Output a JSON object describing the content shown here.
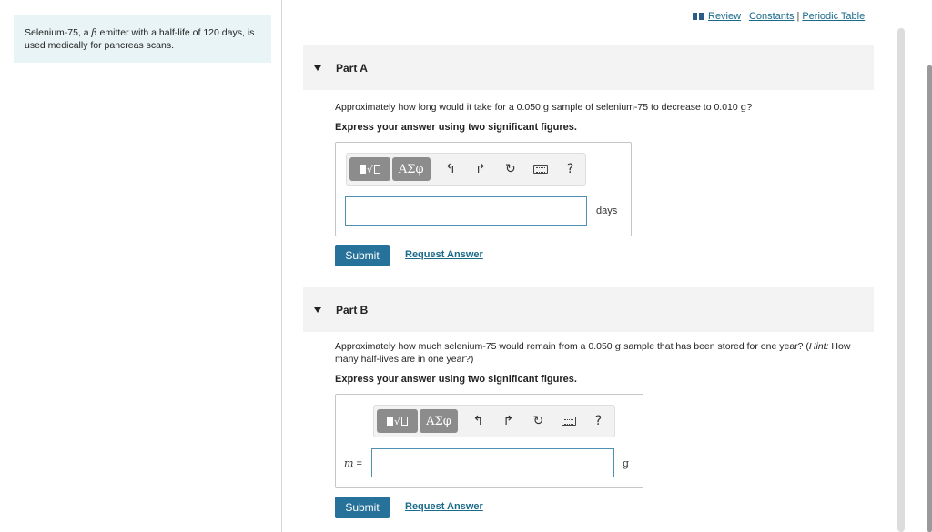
{
  "intro": {
    "text_before_beta": "Selenium-75, a ",
    "beta_symbol": "β",
    "text_after_beta": " emitter with a half-life of 120 days, is used medically for pancreas scans."
  },
  "toplinks": {
    "review": "Review",
    "separator": "|",
    "constants": "Constants",
    "periodic_table": "Periodic Table"
  },
  "partA": {
    "title": "Part A",
    "question_a": "Approximately how long would it take for a 0.050 ",
    "question_g1": "g",
    "question_b": " sample of selenium-75 to decrease to 0.010 ",
    "question_g2": "g",
    "question_c": "?",
    "instruction": "Express your answer using two significant figures.",
    "toolbar": {
      "template_icon": "template-icon",
      "greek_label": "ΑΣφ",
      "undo_icon": "↰",
      "redo_icon": "↱",
      "reset_icon": "↻",
      "help_label": "?"
    },
    "input_value": "",
    "unit": "days",
    "submit_label": "Submit",
    "request_label": "Request Answer"
  },
  "partB": {
    "title": "Part B",
    "question_a": "Approximately how much selenium-75 would remain from a 0.050 ",
    "question_g": "g",
    "question_b": " sample that has been stored for one year? (",
    "hint_label": "Hint:",
    "question_c": " How many half-lives are in one year?)",
    "instruction": "Express your answer using two significant figures.",
    "variable": "m",
    "equals": " =",
    "toolbar": {
      "greek_label": "ΑΣφ",
      "undo_icon": "↰",
      "redo_icon": "↱",
      "reset_icon": "↻",
      "help_label": "?"
    },
    "input_value": "",
    "unit": "g",
    "submit_label": "Submit",
    "request_label": "Request Answer"
  },
  "colors": {
    "accent": "#26729a",
    "link": "#1a6a8a",
    "intro_bg": "#e9f4f6",
    "part_header_bg": "#f3f3f3",
    "input_border": "#4f8fb2"
  }
}
